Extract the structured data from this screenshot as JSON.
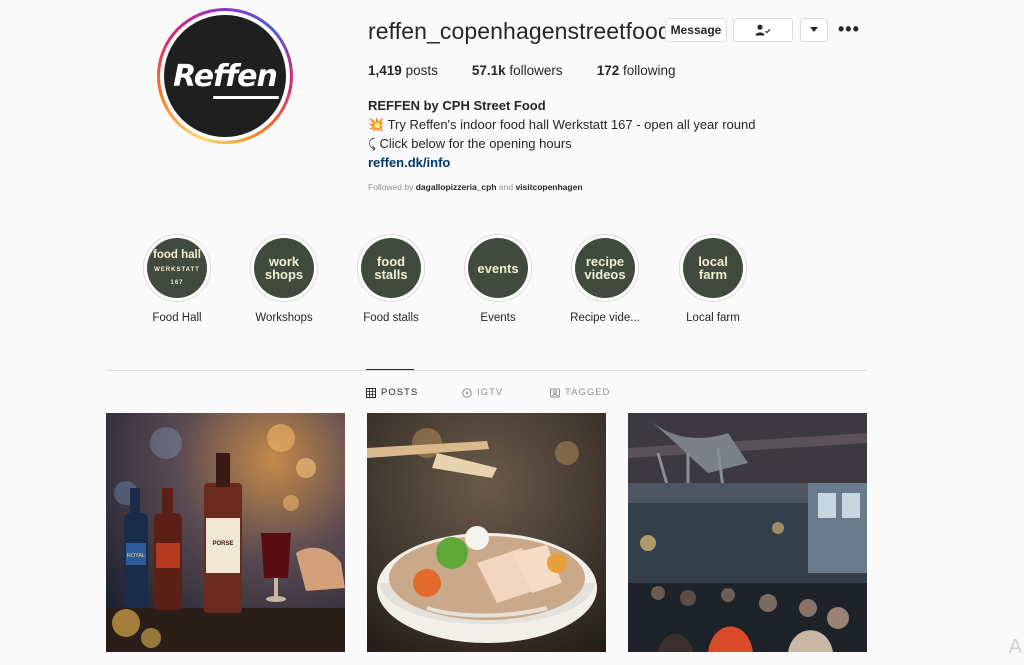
{
  "profile": {
    "username": "reffen_copenhagenstreetfood",
    "avatar_text": "Reffen",
    "buttons": {
      "message": "Message",
      "following_icon": "person-check-icon",
      "dropdown_icon": "chevron-down-icon",
      "more": "•••"
    },
    "stats": {
      "posts_count": "1,419",
      "posts_label": "posts",
      "followers_count": "57.1k",
      "followers_label": "followers",
      "following_count": "172",
      "following_label": "following"
    },
    "bio": {
      "name": "REFFEN by CPH Street Food",
      "line1_emoji": "💥",
      "line1": "Try Reffen's indoor food hall Werkstatt 167 - open all year round",
      "line2_emoji": "⤹",
      "line2": "Click below for the opening hours",
      "link": "reffen.dk/info"
    },
    "followed_by": {
      "prefix": "Followed by",
      "user1": "dagallopizzeria_cph",
      "and": "and",
      "user2": "visitcopenhagen"
    }
  },
  "highlights": [
    {
      "cover_line1": "food hall",
      "cover_line2": "WERKSTATT 167",
      "label": "Food Hall"
    },
    {
      "cover_line1": "work",
      "cover_line2": "shops",
      "label": "Workshops"
    },
    {
      "cover_line1": "food",
      "cover_line2": "stalls",
      "label": "Food stalls"
    },
    {
      "cover_line1": "events",
      "cover_line2": "",
      "label": "Events"
    },
    {
      "cover_line1": "recipe",
      "cover_line2": "videos",
      "label": "Recipe vide..."
    },
    {
      "cover_line1": "local",
      "cover_line2": "farm",
      "label": "Local farm"
    }
  ],
  "tabs": [
    {
      "label": "POSTS",
      "icon": "grid-icon",
      "active": true
    },
    {
      "label": "IGTV",
      "icon": "igtv-icon",
      "active": false
    },
    {
      "label": "TAGGED",
      "icon": "tagged-icon",
      "active": false
    }
  ],
  "posts": [
    {
      "bottle1": "ROYAL",
      "bottle3": "PORSE"
    },
    {},
    {}
  ],
  "watermark": "A"
}
